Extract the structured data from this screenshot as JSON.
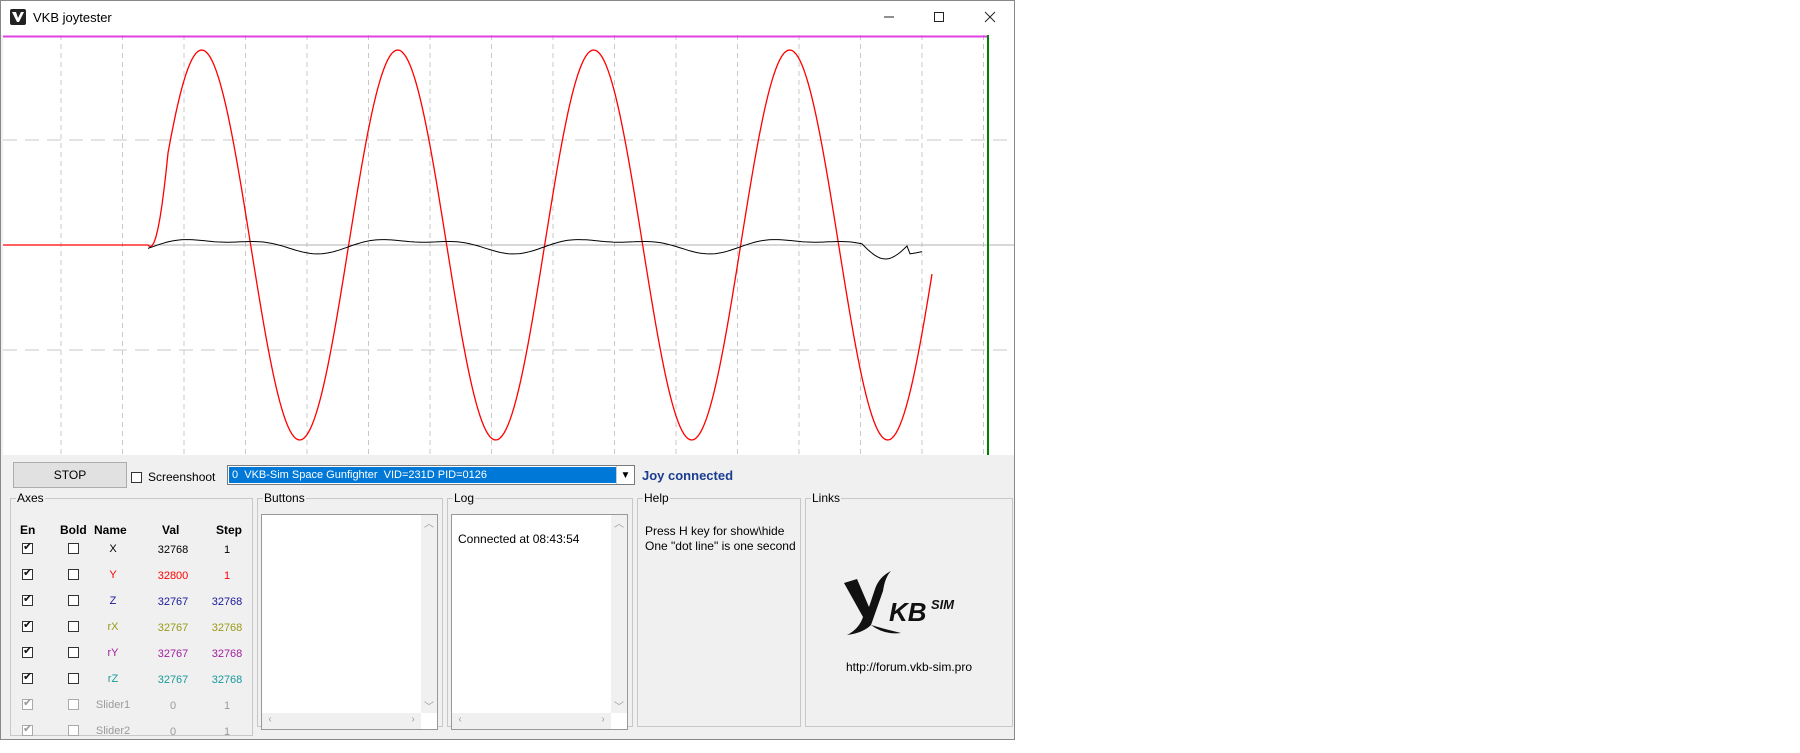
{
  "window": {
    "title": "VKB joytester",
    "minimize_icon": "minimize-icon",
    "maximize_icon": "maximize-icon",
    "close_icon": "close-icon"
  },
  "plot": {
    "colors": {
      "y_trace": "#ff0000",
      "x_trace": "#000000",
      "top_line": "#e040e0",
      "cursor": "#008000"
    }
  },
  "toolbar": {
    "stop_label": "STOP",
    "screenshot_label": "Screenshoot",
    "screenshot_checked": false,
    "device_selected": "0  VKB-Sim Space Gunfighter  VID=231D PID=0126",
    "status": "Joy connected"
  },
  "axes": {
    "group_label": "Axes",
    "headers": {
      "en": "En",
      "bold": "Bold",
      "name": "Name",
      "val": "Val",
      "step": "Step"
    },
    "rows": [
      {
        "name": "X",
        "val": "32768",
        "step": "1",
        "color": "#000000",
        "enabled": true,
        "bold": false,
        "disabled": false
      },
      {
        "name": "Y",
        "val": "32800",
        "step": "1",
        "color": "#ff0000",
        "enabled": true,
        "bold": false,
        "disabled": false
      },
      {
        "name": "Z",
        "val": "32767",
        "step": "32768",
        "color": "#1a1a99",
        "enabled": true,
        "bold": false,
        "disabled": false
      },
      {
        "name": "rX",
        "val": "32767",
        "step": "32768",
        "color": "#9a9a1a",
        "enabled": true,
        "bold": false,
        "disabled": false
      },
      {
        "name": "rY",
        "val": "32767",
        "step": "32768",
        "color": "#a020a0",
        "enabled": true,
        "bold": false,
        "disabled": false
      },
      {
        "name": "rZ",
        "val": "32767",
        "step": "32768",
        "color": "#1a9a9a",
        "enabled": true,
        "bold": false,
        "disabled": false
      },
      {
        "name": "Slider1",
        "val": "0",
        "step": "1",
        "color": "#9a9a9a",
        "enabled": true,
        "bold": false,
        "disabled": true
      },
      {
        "name": "Slider2",
        "val": "0",
        "step": "1",
        "color": "#9a9a9a",
        "enabled": true,
        "bold": false,
        "disabled": true
      }
    ]
  },
  "buttons": {
    "group_label": "Buttons"
  },
  "log": {
    "group_label": "Log",
    "entries": [
      "Connected at 08:43:54"
    ]
  },
  "help": {
    "group_label": "Help",
    "text": "Press H key for show\\hide\nOne \"dot line\" is one second"
  },
  "links": {
    "group_label": "Links",
    "logo_text": "KBSIM",
    "url": "http://forum.vkb-sim.pro"
  }
}
